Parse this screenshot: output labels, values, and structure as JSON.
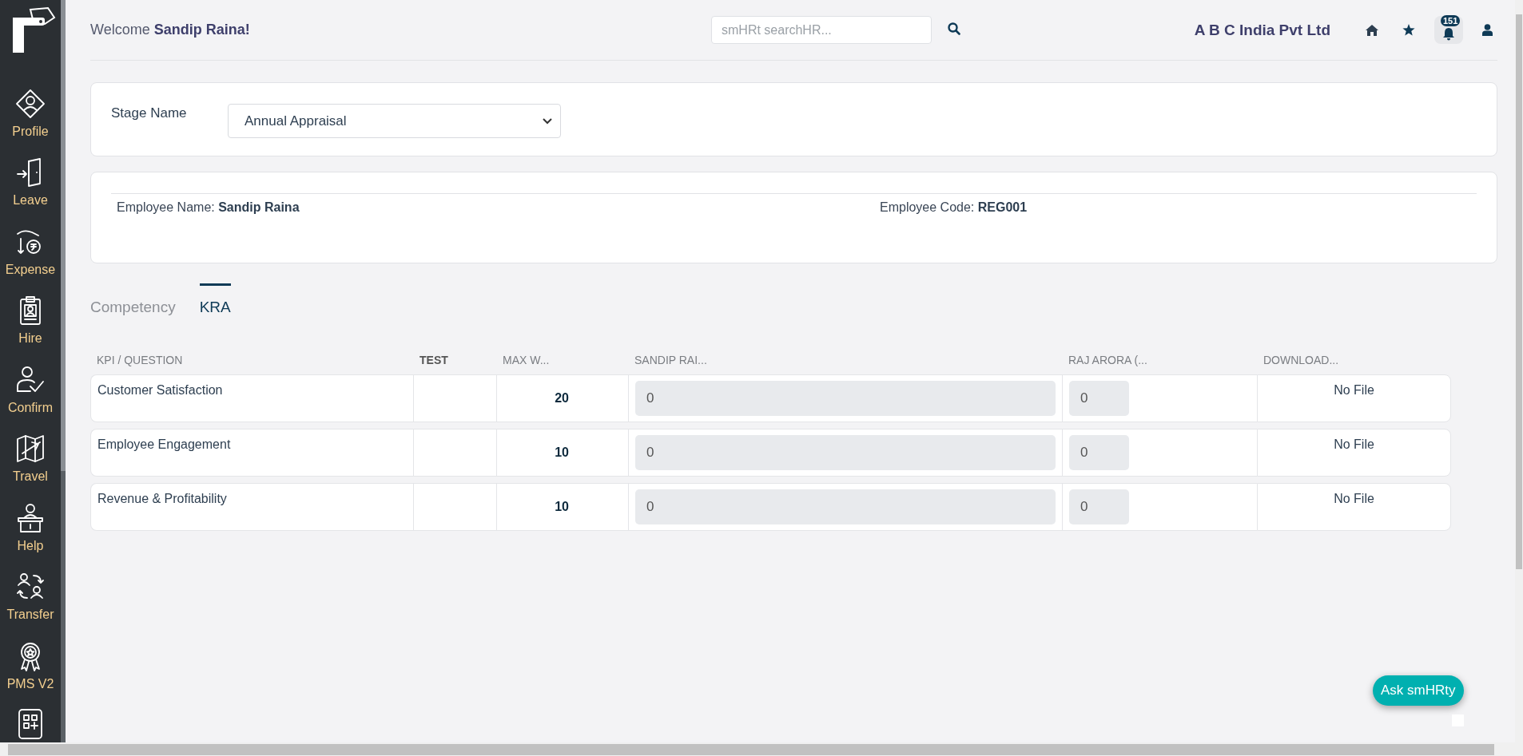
{
  "sidebar": {
    "items": [
      {
        "label": "Profile",
        "selected": false
      },
      {
        "label": "Leave",
        "selected": false
      },
      {
        "label": "Expense",
        "selected": false
      },
      {
        "label": "Hire",
        "selected": false
      },
      {
        "label": "Confirm",
        "selected": false
      },
      {
        "label": "Travel",
        "selected": false
      },
      {
        "label": "Help",
        "selected": false
      },
      {
        "label": "Transfer",
        "selected": false
      },
      {
        "label": "PMS V2",
        "selected": false
      }
    ]
  },
  "header": {
    "welcome": "Welcome **Sandip Raina!**",
    "search": {
      "placeholder": "smHRt searchHR..."
    },
    "company": "A B C India Pvt Ltd",
    "notification_count": "151"
  },
  "stage": {
    "label": "Stage Name",
    "value": "Annual Appraisal"
  },
  "employee": {
    "name": "Employee Name: **Sandip Raina**",
    "code": "Employee Code: **REG001**"
  },
  "tabs": [
    {
      "label": "Competency",
      "selected": false
    },
    {
      "label": "KRA",
      "selected": true
    }
  ],
  "table": {
    "columns": [
      {
        "label": "KPI / QUESTION",
        "emphasized": false
      },
      {
        "label": "TEST",
        "emphasized": true
      },
      {
        "label": "MAX W...",
        "emphasized": false
      },
      {
        "label": "SANDIP RAI...",
        "emphasized": false
      },
      {
        "label": "RAJ ARORA (...",
        "emphasized": false
      },
      {
        "label": "DOWNLOAD...",
        "emphasized": false
      }
    ],
    "rows": [
      {
        "kpi": "Customer Satisfaction",
        "test": "",
        "max_weight": "20",
        "self_score": "0",
        "manager_score": "0",
        "download": "No File"
      },
      {
        "kpi": "Employee Engagement",
        "test": "",
        "max_weight": "10",
        "self_score": "0",
        "manager_score": "0",
        "download": "No File"
      },
      {
        "kpi": "Revenue & Profitability",
        "test": "",
        "max_weight": "10",
        "self_score": "0",
        "manager_score": "0",
        "download": "No File"
      }
    ]
  },
  "chat_button": "Ask smHRty"
}
